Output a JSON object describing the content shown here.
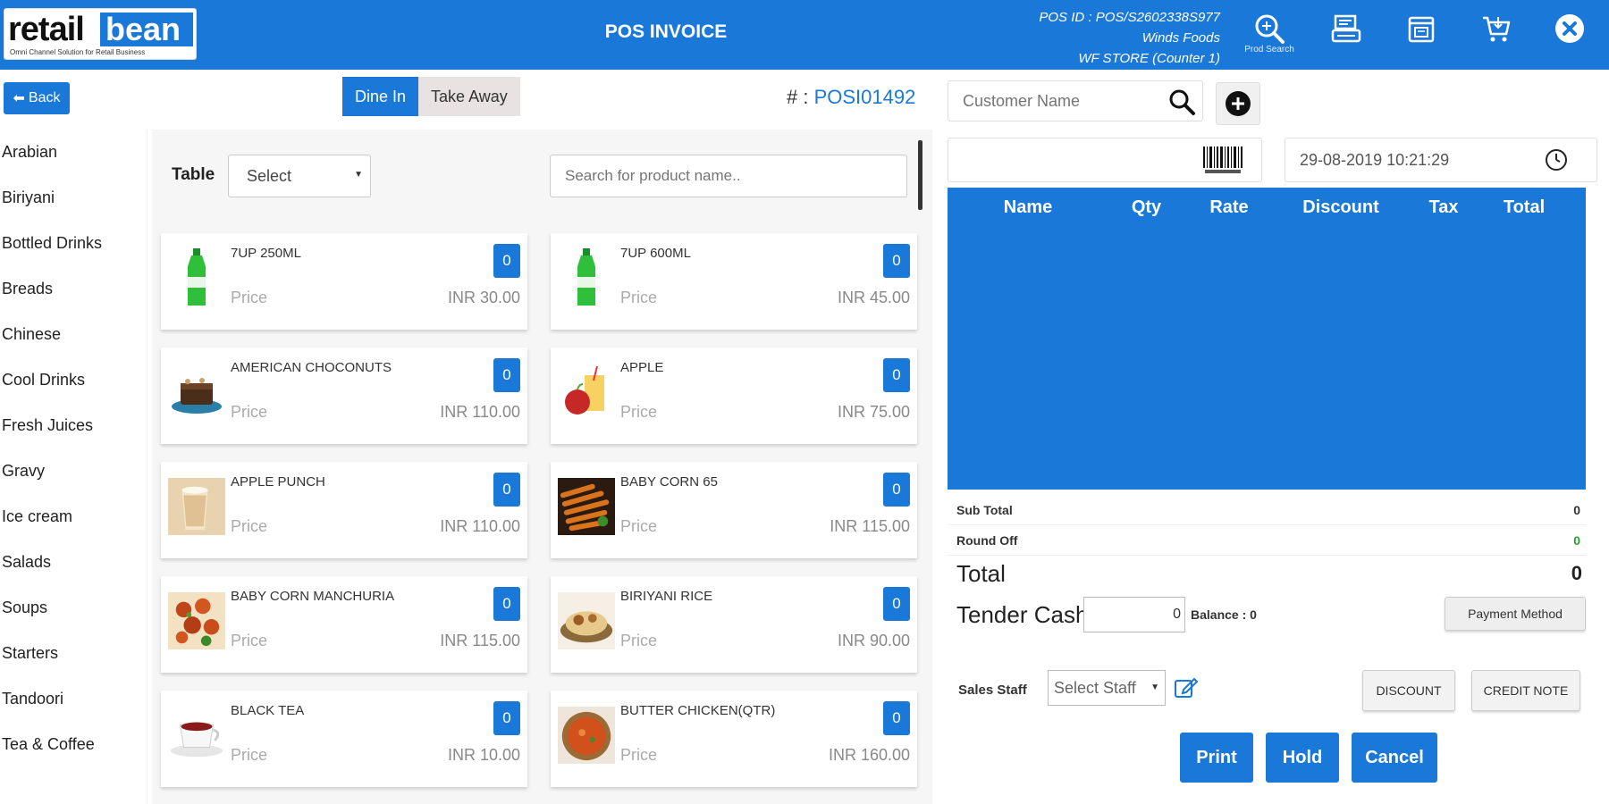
{
  "header": {
    "logo_word1": "retail",
    "logo_word2": "bean",
    "logo_tagline": "Omni Channel Solution for Retail Business",
    "title": "POS INVOICE",
    "pos_id": "POS ID : POS/S2602338S977",
    "company": "Winds Foods",
    "store": "WF STORE (Counter 1)",
    "prod_search_caption": "Prod Search",
    "icons": [
      "prod-search-icon",
      "register-icon",
      "printer-icon",
      "cart-icon",
      "close-icon"
    ]
  },
  "left": {
    "back_label": "Back",
    "tabs": [
      {
        "label": "Dine In",
        "active": true
      },
      {
        "label": "Take Away",
        "active": false
      }
    ],
    "invoice_prefix": "# : ",
    "invoice_no": "POSI01492",
    "table_label": "Table",
    "table_select_value": "Select",
    "search_placeholder": "Search for product name..",
    "categories": [
      "Arabian",
      "Biriyani",
      "Bottled Drinks",
      "Breads",
      "Chinese",
      "Cool Drinks",
      "Fresh Juices",
      "Gravy",
      "Ice cream",
      "Salads",
      "Soups",
      "Starters",
      "Tandoori",
      "Tea & Coffee"
    ],
    "products": [
      {
        "name": "7UP 250ML",
        "qty": "0",
        "price_label": "Price",
        "price": "INR 30.00",
        "img": "green-bottle"
      },
      {
        "name": "7UP 600ML",
        "qty": "0",
        "price_label": "Price",
        "price": "INR 45.00",
        "img": "green-bottle"
      },
      {
        "name": "AMERICAN CHOCONUTS",
        "qty": "0",
        "price_label": "Price",
        "price": "INR 110.00",
        "img": "dessert"
      },
      {
        "name": "APPLE",
        "qty": "0",
        "price_label": "Price",
        "price": "INR 75.00",
        "img": "apple-juice"
      },
      {
        "name": "APPLE PUNCH",
        "qty": "0",
        "price_label": "Price",
        "price": "INR 110.00",
        "img": "punch"
      },
      {
        "name": "BABY CORN 65",
        "qty": "0",
        "price_label": "Price",
        "price": "INR 115.00",
        "img": "fried"
      },
      {
        "name": "BABY CORN MANCHURIA",
        "qty": "0",
        "price_label": "Price",
        "price": "INR 115.00",
        "img": "manchuria"
      },
      {
        "name": "BIRIYANI RICE",
        "qty": "0",
        "price_label": "Price",
        "price": "INR 90.00",
        "img": "rice"
      },
      {
        "name": "BLACK TEA",
        "qty": "0",
        "price_label": "Price",
        "price": "INR 10.00",
        "img": "tea"
      },
      {
        "name": "BUTTER CHICKEN(QTR)",
        "qty": "0",
        "price_label": "Price",
        "price": "INR 160.00",
        "img": "curry"
      }
    ]
  },
  "right": {
    "customer_placeholder": "Customer Name",
    "datetime": "29-08-2019 10:21:29",
    "cart_columns": [
      "Name",
      "Qty",
      "Rate",
      "Discount",
      "Tax",
      "Total"
    ],
    "sub_total_label": "Sub Total",
    "sub_total_value": "0",
    "round_off_label": "Round Off",
    "round_off_value": "0",
    "total_label": "Total",
    "total_value": "0",
    "tender_label": "Tender Cash",
    "tender_value": "0",
    "balance_label": "Balance : 0",
    "payment_method_label": "Payment Method",
    "sales_staff_label": "Sales Staff",
    "staff_select_value": "Select Staff",
    "discount_label": "DISCOUNT",
    "credit_note_label": "CREDIT NOTE",
    "print_label": "Print",
    "hold_label": "Hold",
    "cancel_label": "Cancel"
  },
  "colors": {
    "primary": "#1a78d9",
    "tab_inactive": "#e8e2e2"
  }
}
